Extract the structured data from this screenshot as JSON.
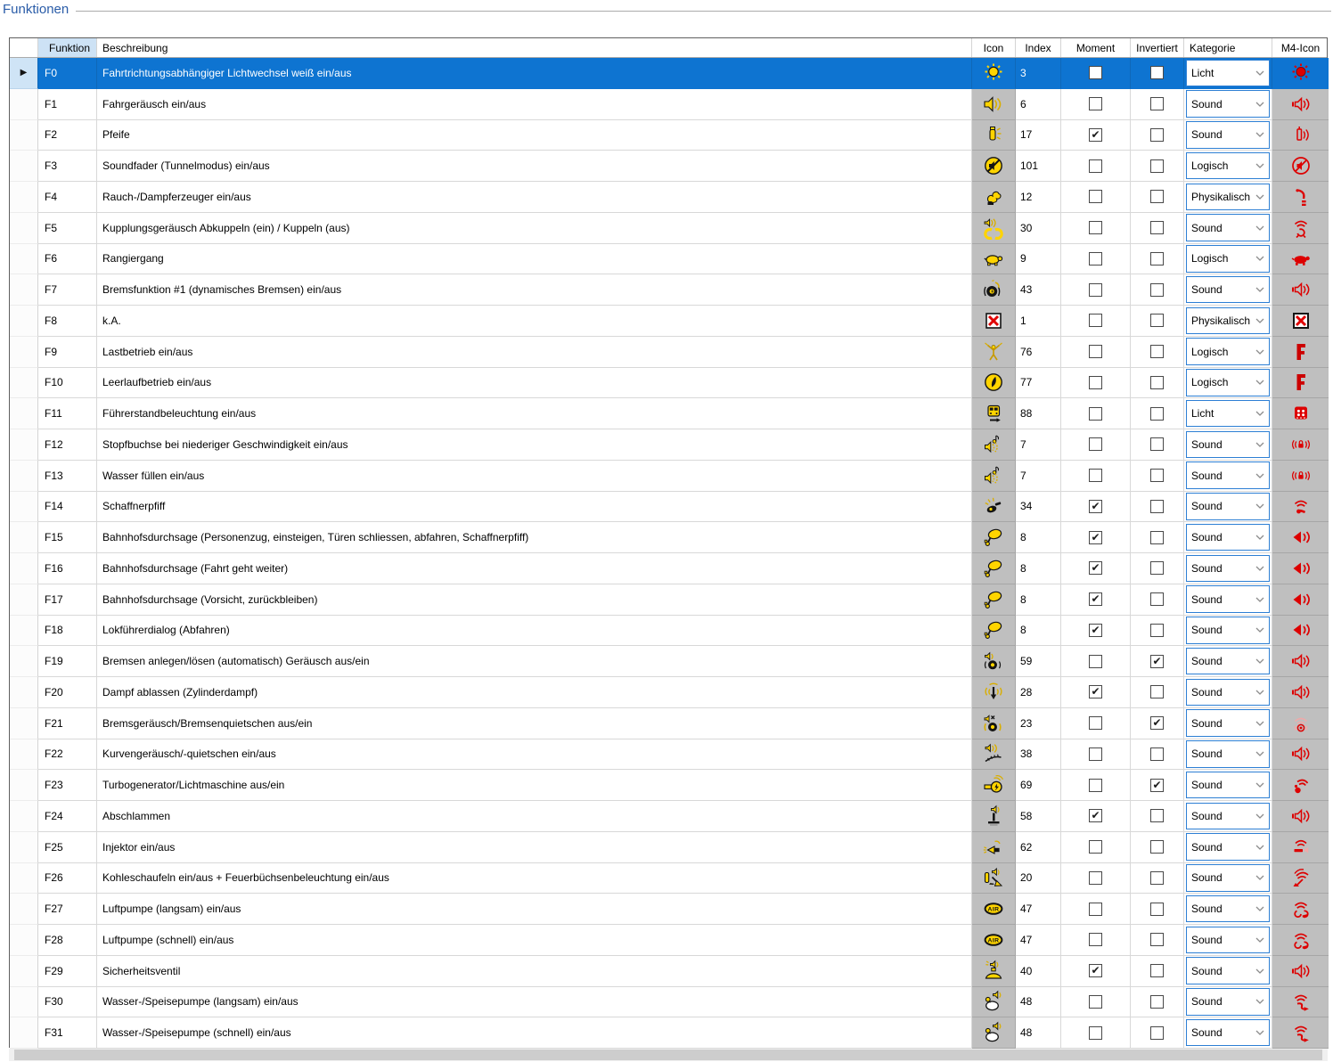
{
  "caption": "Funktionen",
  "columns": {
    "funktion": "Funktion",
    "beschreibung": "Beschreibung",
    "icon": "Icon",
    "index": "Index",
    "moment": "Moment",
    "invertiert": "Invertiert",
    "kategorie": "Kategorie",
    "m4": "M4-Icon"
  },
  "colors": {
    "selection_blue": "#0e74d1",
    "header_highlight": "#cde2f5",
    "icon_cell_gray": "#bfbfbf",
    "icon_yellow": "#ffd400",
    "m4_red": "#dd0000",
    "combo_border": "#2d7fd4",
    "caption_blue": "#2a5ca8"
  },
  "rows": [
    {
      "funktion": "F0",
      "beschreibung": "Fahrtrichtungsabhängiger Lichtwechsel weiß ein/aus",
      "icon": "sun-light-icon",
      "index": "3",
      "moment": false,
      "invertiert": false,
      "kategorie": "Licht",
      "m4_icon": "m4-light-icon",
      "selected": true
    },
    {
      "funktion": "F1",
      "beschreibung": "Fahrgeräusch ein/aus",
      "icon": "speaker-waves-icon",
      "index": "6",
      "moment": false,
      "invertiert": false,
      "kategorie": "Sound",
      "m4_icon": "m4-speaker-icon",
      "selected": false
    },
    {
      "funktion": "F2",
      "beschreibung": "Pfeife",
      "icon": "whistle-icon",
      "index": "17",
      "moment": true,
      "invertiert": false,
      "kategorie": "Sound",
      "m4_icon": "m4-whistle-icon",
      "selected": false
    },
    {
      "funktion": "F3",
      "beschreibung": "Soundfader (Tunnelmodus) ein/aus",
      "icon": "mute-circle-icon",
      "index": "101",
      "moment": false,
      "invertiert": false,
      "kategorie": "Logisch",
      "m4_icon": "m4-mute-icon",
      "selected": false
    },
    {
      "funktion": "F4",
      "beschreibung": "Rauch-/Dampferzeuger ein/aus",
      "icon": "smoke-generator-icon",
      "index": "12",
      "moment": false,
      "invertiert": false,
      "kategorie": "Physikalisch",
      "m4_icon": "m4-smoke-icon",
      "selected": false
    },
    {
      "funktion": "F5",
      "beschreibung": "Kupplungsgeräusch Abkuppeln (ein) / Kuppeln (aus)",
      "icon": "coupler-sound-icon",
      "index": "30",
      "moment": false,
      "invertiert": false,
      "kategorie": "Sound",
      "m4_icon": "m4-coupler-wifi-icon",
      "selected": false
    },
    {
      "funktion": "F6",
      "beschreibung": "Rangiergang",
      "icon": "turtle-icon",
      "index": "9",
      "moment": false,
      "invertiert": false,
      "kategorie": "Logisch",
      "m4_icon": "m4-turtle-icon",
      "selected": false
    },
    {
      "funktion": "F7",
      "beschreibung": "Bremsfunktion #1 (dynamisches Bremsen) ein/aus",
      "icon": "brake-sound-icon",
      "index": "43",
      "moment": false,
      "invertiert": false,
      "kategorie": "Sound",
      "m4_icon": "m4-speaker-icon",
      "selected": false
    },
    {
      "funktion": "F8",
      "beschreibung": "k.A.",
      "icon": "red-x-icon",
      "index": "1",
      "moment": false,
      "invertiert": false,
      "kategorie": "Physikalisch",
      "m4_icon": "m4-red-x-icon",
      "selected": false
    },
    {
      "funktion": "F9",
      "beschreibung": "Lastbetrieb ein/aus",
      "icon": "load-figure-icon",
      "index": "76",
      "moment": false,
      "invertiert": false,
      "kategorie": "Logisch",
      "m4_icon": "m4-letter-f-icon",
      "selected": false
    },
    {
      "funktion": "F10",
      "beschreibung": "Leerlaufbetrieb ein/aus",
      "icon": "idle-circle-icon",
      "index": "77",
      "moment": false,
      "invertiert": false,
      "kategorie": "Logisch",
      "m4_icon": "m4-letter-f-icon",
      "selected": false
    },
    {
      "funktion": "F11",
      "beschreibung": "Führerstandbeleuchtung ein/aus",
      "icon": "cab-light-icon",
      "index": "88",
      "moment": false,
      "invertiert": false,
      "kategorie": "Licht",
      "m4_icon": "m4-cab-icon",
      "selected": false
    },
    {
      "funktion": "F12",
      "beschreibung": "Stopfbuchse bei niederiger Geschwindigkeit ein/aus",
      "icon": "note-speaker-icon",
      "index": "7",
      "moment": false,
      "invertiert": false,
      "kategorie": "Sound",
      "m4_icon": "m4-lock-sound-icon",
      "selected": false
    },
    {
      "funktion": "F13",
      "beschreibung": "Wasser füllen ein/aus",
      "icon": "note-speaker-icon",
      "index": "7",
      "moment": false,
      "invertiert": false,
      "kategorie": "Sound",
      "m4_icon": "m4-lock-sound-icon",
      "selected": false
    },
    {
      "funktion": "F14",
      "beschreibung": "Schaffnerpfiff",
      "icon": "conductor-whistle-icon",
      "index": "34",
      "moment": true,
      "invertiert": false,
      "kategorie": "Sound",
      "m4_icon": "m4-wifi-whistle-icon",
      "selected": false
    },
    {
      "funktion": "F15",
      "beschreibung": "Bahnhofsdurchsage (Personenzug, einsteigen, Türen schliessen, abfahren, Schaffnerpfiff)",
      "icon": "megaphone-icon",
      "index": "8",
      "moment": true,
      "invertiert": false,
      "kategorie": "Sound",
      "m4_icon": "m4-speaker-solid-icon",
      "selected": false
    },
    {
      "funktion": "F16",
      "beschreibung": "Bahnhofsdurchsage (Fahrt geht weiter)",
      "icon": "megaphone-icon",
      "index": "8",
      "moment": true,
      "invertiert": false,
      "kategorie": "Sound",
      "m4_icon": "m4-speaker-solid-icon",
      "selected": false
    },
    {
      "funktion": "F17",
      "beschreibung": "Bahnhofsdurchsage (Vorsicht, zurückbleiben)",
      "icon": "megaphone-icon",
      "index": "8",
      "moment": true,
      "invertiert": false,
      "kategorie": "Sound",
      "m4_icon": "m4-speaker-solid-icon",
      "selected": false
    },
    {
      "funktion": "F18",
      "beschreibung": "Lokführerdialog (Abfahren)",
      "icon": "megaphone-icon",
      "index": "8",
      "moment": true,
      "invertiert": false,
      "kategorie": "Sound",
      "m4_icon": "m4-speaker-solid-icon",
      "selected": false
    },
    {
      "funktion": "F19",
      "beschreibung": "Bremsen anlegen/lösen (automatisch) Geräusch aus/ein",
      "icon": "brake-speaker-icon",
      "index": "59",
      "moment": false,
      "invertiert": true,
      "kategorie": "Sound",
      "m4_icon": "m4-speaker-icon",
      "selected": false
    },
    {
      "funktion": "F20",
      "beschreibung": "Dampf ablassen (Zylinderdampf)",
      "icon": "steam-release-icon",
      "index": "28",
      "moment": true,
      "invertiert": false,
      "kategorie": "Sound",
      "m4_icon": "m4-speaker-icon",
      "selected": false
    },
    {
      "funktion": "F21",
      "beschreibung": "Bremsgeräusch/Bremsenquietschen aus/ein",
      "icon": "brake-mute-icon",
      "index": "23",
      "moment": false,
      "invertiert": true,
      "kategorie": "Sound",
      "m4_icon": "m4-wifi-brake-dim-icon",
      "selected": false
    },
    {
      "funktion": "F22",
      "beschreibung": "Kurvengeräusch/-quietschen ein/aus",
      "icon": "curve-squeal-icon",
      "index": "38",
      "moment": false,
      "invertiert": false,
      "kategorie": "Sound",
      "m4_icon": "m4-speaker-icon",
      "selected": false
    },
    {
      "funktion": "F23",
      "beschreibung": "Turbogenerator/Lichtmaschine aus/ein",
      "icon": "generator-icon",
      "index": "69",
      "moment": false,
      "invertiert": true,
      "kategorie": "Sound",
      "m4_icon": "m4-wifi-generator-icon",
      "selected": false
    },
    {
      "funktion": "F24",
      "beschreibung": "Abschlammen",
      "icon": "blowdown-icon",
      "index": "58",
      "moment": true,
      "invertiert": false,
      "kategorie": "Sound",
      "m4_icon": "m4-speaker-icon",
      "selected": false
    },
    {
      "funktion": "F25",
      "beschreibung": "Injektor ein/aus",
      "icon": "injector-icon",
      "index": "62",
      "moment": false,
      "invertiert": false,
      "kategorie": "Sound",
      "m4_icon": "m4-wifi-injector-icon",
      "selected": false
    },
    {
      "funktion": "F26",
      "beschreibung": "Kohleschaufeln ein/aus + Feuerbüchsenbeleuchtung ein/aus",
      "icon": "coal-shovel-icon",
      "index": "20",
      "moment": false,
      "invertiert": false,
      "kategorie": "Sound",
      "m4_icon": "m4-wifi-shovel-icon",
      "selected": false
    },
    {
      "funktion": "F27",
      "beschreibung": "Luftpumpe (langsam) ein/aus",
      "icon": "air-badge-icon",
      "index": "47",
      "moment": false,
      "invertiert": false,
      "kategorie": "Sound",
      "m4_icon": "m4-wifi-pump-icon",
      "selected": false
    },
    {
      "funktion": "F28",
      "beschreibung": "Luftpumpe (schnell) ein/aus",
      "icon": "air-badge-icon",
      "index": "47",
      "moment": false,
      "invertiert": false,
      "kategorie": "Sound",
      "m4_icon": "m4-wifi-pump-icon",
      "selected": false
    },
    {
      "funktion": "F29",
      "beschreibung": "Sicherheitsventil",
      "icon": "safety-valve-icon",
      "index": "40",
      "moment": true,
      "invertiert": false,
      "kategorie": "Sound",
      "m4_icon": "m4-speaker-icon",
      "selected": false
    },
    {
      "funktion": "F30",
      "beschreibung": "Wasser-/Speisepumpe (langsam) ein/aus",
      "icon": "water-pump-icon",
      "index": "48",
      "moment": false,
      "invertiert": false,
      "kategorie": "Sound",
      "m4_icon": "m4-wifi-waterpump-icon",
      "selected": false
    },
    {
      "funktion": "F31",
      "beschreibung": "Wasser-/Speisepumpe (schnell) ein/aus",
      "icon": "water-pump-icon",
      "index": "48",
      "moment": false,
      "invertiert": false,
      "kategorie": "Sound",
      "m4_icon": "m4-wifi-waterpump-icon",
      "selected": false
    }
  ]
}
